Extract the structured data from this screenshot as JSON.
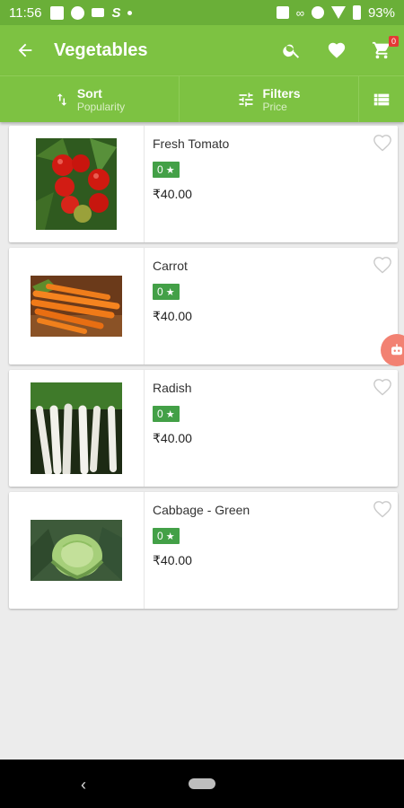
{
  "status_bar": {
    "time": "11:56",
    "battery": "93%",
    "icons": [
      "image-icon",
      "facebook-icon",
      "send-icon",
      "s-app-icon",
      "dot-icon",
      "vibrate-icon",
      "link-icon",
      "data-saver-icon",
      "wifi-icon",
      "battery-icon"
    ]
  },
  "app_bar": {
    "title": "Vegetables",
    "back_icon": "arrow-back-icon",
    "search_icon": "search-icon",
    "wishlist_icon": "heart-icon",
    "cart_icon": "cart-icon",
    "cart_count": "0"
  },
  "sort_bar": {
    "sort_label": "Sort",
    "sort_sub": "Popularity",
    "filter_label": "Filters",
    "filter_sub": "Price"
  },
  "products": [
    {
      "name": "Fresh Tomato",
      "rating": "0",
      "price": "₹40.00"
    },
    {
      "name": "Carrot",
      "rating": "0",
      "price": "₹40.00"
    },
    {
      "name": "Radish",
      "rating": "0",
      "price": "₹40.00"
    },
    {
      "name": "Cabbage - Green",
      "rating": "0",
      "price": "₹40.00"
    }
  ],
  "colors": {
    "status_bar": "#6aaf38",
    "app_bar": "#7dc242",
    "rating_badge": "#43a047",
    "cart_badge": "#e53935",
    "floating_button": "#f28172"
  }
}
